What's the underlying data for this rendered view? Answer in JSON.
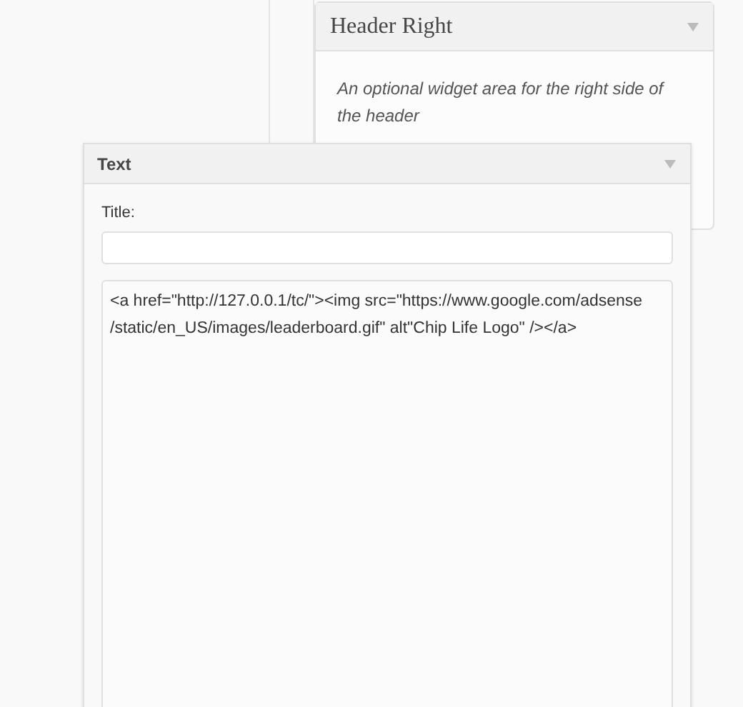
{
  "header_right_widget": {
    "title": "Header Right",
    "description": "An optional widget area for the right side of the header"
  },
  "text_widget": {
    "title": "Text",
    "title_label": "Title:",
    "content": "<a href=\"http://127.0.0.1/tc/\"><img src=\"https://www.google.com/adsense/static/en_US/images/leaderboard.gif\" alt\"Chip Life Logo\" /></a>"
  }
}
